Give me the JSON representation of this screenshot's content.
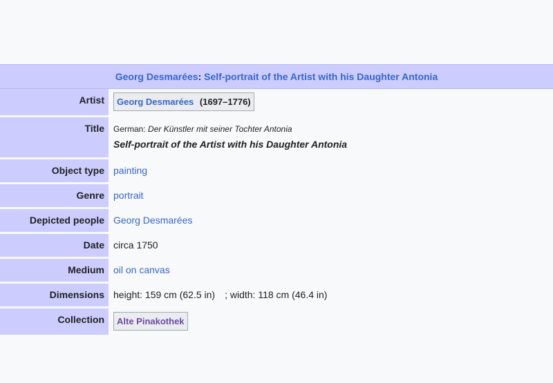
{
  "header": {
    "artist_link": "Georg Desmarées",
    "colon": ":",
    "title_link": "Self-portrait of the Artist with his Daughter Antonia"
  },
  "rows": {
    "artist": {
      "label": "Artist",
      "name": "Georg Desmarées",
      "years": "(1697–1776)"
    },
    "title": {
      "label": "Title",
      "lang_prefix": "German:",
      "original": "Der Künstler mit seiner Tochter Antonia",
      "english": "Self-portrait of the Artist with his Daughter Antonia"
    },
    "object_type": {
      "label": "Object type",
      "value": "painting"
    },
    "genre": {
      "label": "Genre",
      "value": "portrait"
    },
    "depicted": {
      "label": "Depicted people",
      "value": "Georg Desmarées"
    },
    "date": {
      "label": "Date",
      "value": "circa 1750"
    },
    "medium": {
      "label": "Medium",
      "value": "oil on canvas"
    },
    "dimensions": {
      "label": "Dimensions",
      "height": "height: 159 cm (62.5 in)",
      "width": "; width: 118 cm (46.4 in)"
    },
    "collection": {
      "label": "Collection",
      "value": "Alte Pinakothek"
    }
  },
  "colors": {
    "label_bg": "#ccccff",
    "link": "#3366cc",
    "visited_link": "#6b4ba1",
    "page_bg": "#f8f9fa"
  }
}
